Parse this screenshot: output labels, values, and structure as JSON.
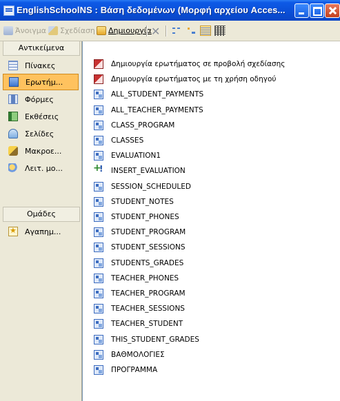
{
  "window": {
    "title": "EnglishSchoolNS : Βάση δεδομένων (Μορφή αρχείου Acces..."
  },
  "toolbar": {
    "open_label": "Άνοιγμα",
    "design_label": "Σχεδίαση",
    "new_label": "Δημιουργία"
  },
  "objects_bar": {
    "header": "Αντικείμενα",
    "items": [
      {
        "label": "Πίνακες",
        "icon": "tables-icon"
      },
      {
        "label": "Ερωτήμ...",
        "icon": "queries-icon",
        "selected": true
      },
      {
        "label": "Φόρμες",
        "icon": "forms-icon"
      },
      {
        "label": "Εκθέσεις",
        "icon": "reports-icon"
      },
      {
        "label": "Σελίδες",
        "icon": "pages-icon"
      },
      {
        "label": "Μακροε...",
        "icon": "macros-icon"
      },
      {
        "label": "Λειτ. μο...",
        "icon": "modules-icon"
      }
    ],
    "groups_header": "Ομάδες",
    "groups": [
      {
        "label": "Αγαπημ...",
        "icon": "favorites-icon"
      }
    ]
  },
  "queries": [
    {
      "label": "Δημιουργία ερωτήματος σε προβολή σχεδίασης",
      "kind": "wizard"
    },
    {
      "label": "Δημιουργία ερωτήματος με τη χρήση οδηγού",
      "kind": "wizard"
    },
    {
      "label": "ALL_STUDENT_PAYMENTS",
      "kind": "select"
    },
    {
      "label": "ALL_TEACHER_PAYMENTS",
      "kind": "select"
    },
    {
      "label": "CLASS_PROGRAM",
      "kind": "select"
    },
    {
      "label": "CLASSES",
      "kind": "select"
    },
    {
      "label": "EVALUATION1",
      "kind": "select"
    },
    {
      "label": "INSERT_EVALUATION",
      "kind": "append"
    },
    {
      "label": "SESSION_SCHEDULED",
      "kind": "select"
    },
    {
      "label": "STUDENT_NOTES",
      "kind": "select"
    },
    {
      "label": "STUDENT_PHONES",
      "kind": "select"
    },
    {
      "label": "STUDENT_PROGRAM",
      "kind": "select"
    },
    {
      "label": "STUDENT_SESSIONS",
      "kind": "select"
    },
    {
      "label": "STUDENTS_GRADES",
      "kind": "select"
    },
    {
      "label": "TEACHER_PHONES",
      "kind": "select"
    },
    {
      "label": "TEACHER_PROGRAM",
      "kind": "select"
    },
    {
      "label": "TEACHER_SESSIONS",
      "kind": "select"
    },
    {
      "label": "TEACHER_STUDENT",
      "kind": "select"
    },
    {
      "label": "THIS_STUDENT_GRADES",
      "kind": "select"
    },
    {
      "label": "ΒΑΘΜΟΛΟΓΙΕΣ",
      "kind": "select"
    },
    {
      "label": "ΠΡΟΓΡΑΜΜΑ",
      "kind": "select"
    }
  ]
}
